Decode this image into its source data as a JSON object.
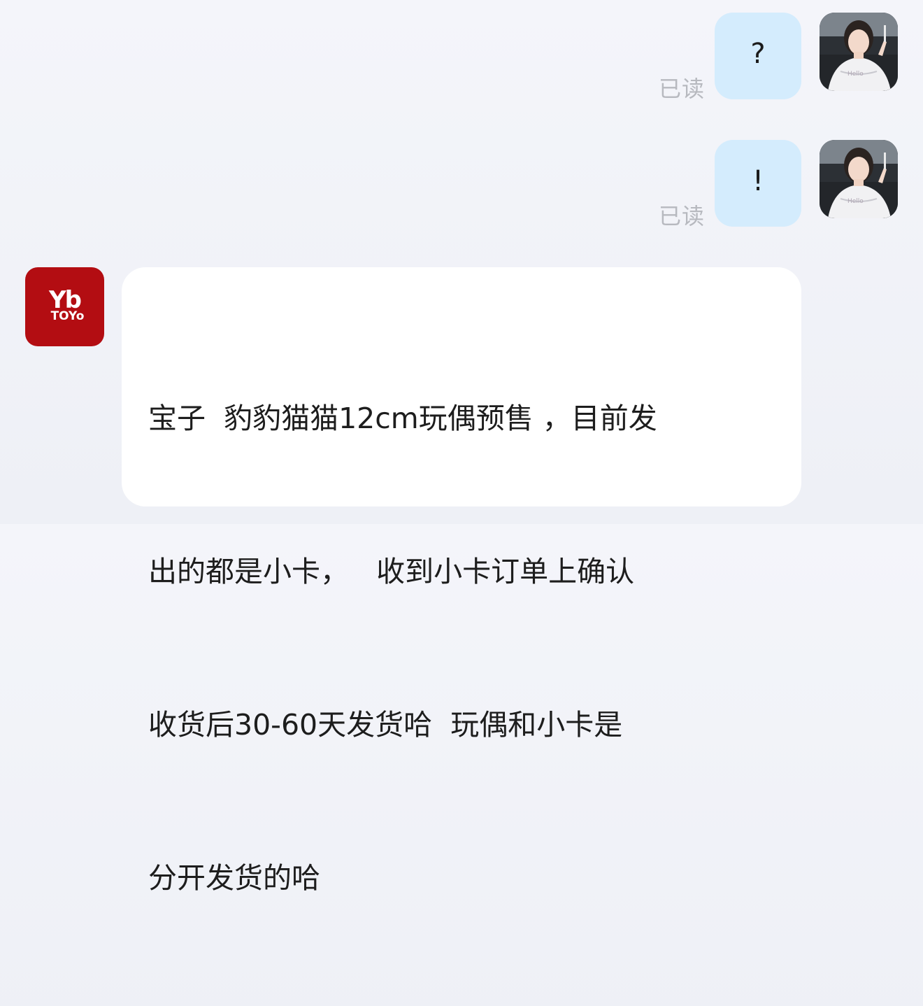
{
  "messages": [
    {
      "direction": "outgoing",
      "text": "?",
      "read_status": "已读"
    },
    {
      "direction": "outgoing",
      "text": "!",
      "read_status": "已读"
    },
    {
      "direction": "incoming",
      "sender_avatar": {
        "logo_top": "Yb",
        "logo_bottom": "TOYo"
      },
      "lines": [
        "宝子  豹豹猫猫12cm玩偶预售 ，目前发",
        "出的都是小卡，   收到小卡订单上确认",
        "收货后30-60天发货哈  玩偶和小卡是",
        "分开发货的哈"
      ]
    }
  ],
  "colors": {
    "outgoing_bubble": "#d4ecfd",
    "incoming_bubble": "#ffffff",
    "brand_red": "#b30d12",
    "read_receipt": "#b7b9bf"
  },
  "icons": {
    "user_avatar": "user-photo-avatar",
    "brand_avatar": "yb-toy-logo"
  }
}
